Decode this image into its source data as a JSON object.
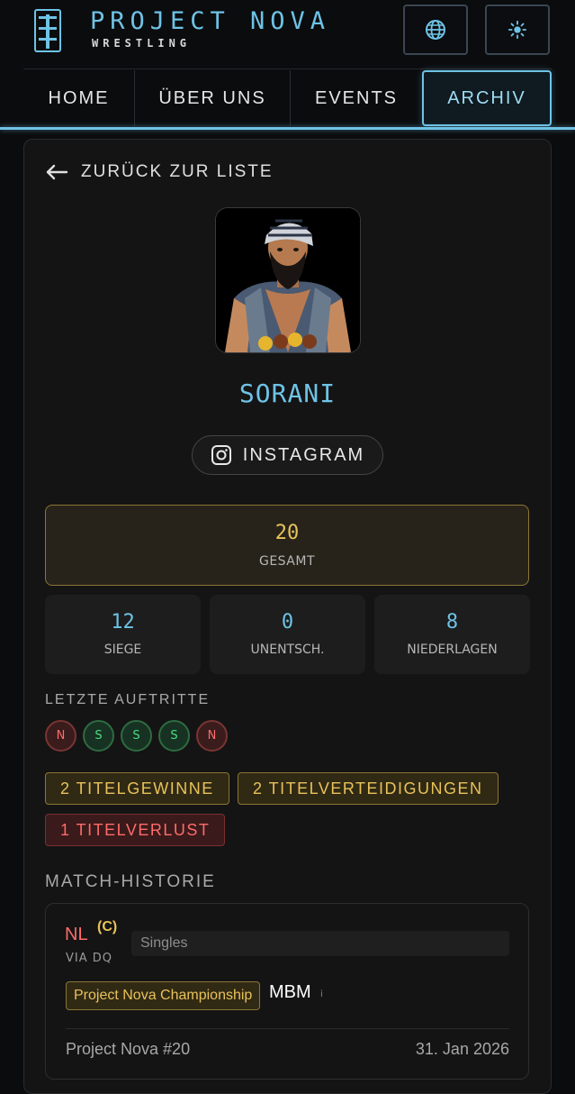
{
  "header": {
    "brand_title": "PROJECT NOVA",
    "brand_subtitle": "WRESTLING",
    "language_icon": "globe-icon",
    "theme_icon": "sun-icon"
  },
  "nav": {
    "tabs": [
      {
        "label": "HOME",
        "active": false
      },
      {
        "label": "ÜBER UNS",
        "active": false
      },
      {
        "label": "EVENTS",
        "active": false
      },
      {
        "label": "ARCHIV",
        "active": true
      }
    ]
  },
  "profile": {
    "back_label": "ZURÜCK ZUR LISTE",
    "name": "SORANI",
    "instagram_label": "INSTAGRAM"
  },
  "stats": {
    "total": {
      "value": "20",
      "label": "GESAMT"
    },
    "wins": {
      "value": "12",
      "label": "SIEGE"
    },
    "draws": {
      "value": "0",
      "label": "UNENTSCH."
    },
    "losses": {
      "value": "8",
      "label": "NIEDERLAGEN"
    }
  },
  "recent": {
    "label": "LETZTE AUFTRITTE",
    "results": [
      "N",
      "S",
      "S",
      "S",
      "N"
    ]
  },
  "titles": {
    "wins": "2 TITELGEWINNE",
    "defenses": "2 TITELVERTEIDIGUNGEN",
    "losses": "1 TITELVERLUST"
  },
  "history": {
    "label": "MATCH-HISTORIE",
    "matches": [
      {
        "result": "NL",
        "champion_mark": "(C)",
        "method": "VIA DQ",
        "type": "Singles",
        "title": "Project Nova Championship",
        "opponent": "MBM",
        "info": "i",
        "event": "Project Nova #20",
        "date": "31. Jan 2026"
      }
    ]
  },
  "colors": {
    "accent": "#6ec3e6",
    "gold": "#e8c25a",
    "loss": "#ff6b6b",
    "win": "#4ade80"
  }
}
